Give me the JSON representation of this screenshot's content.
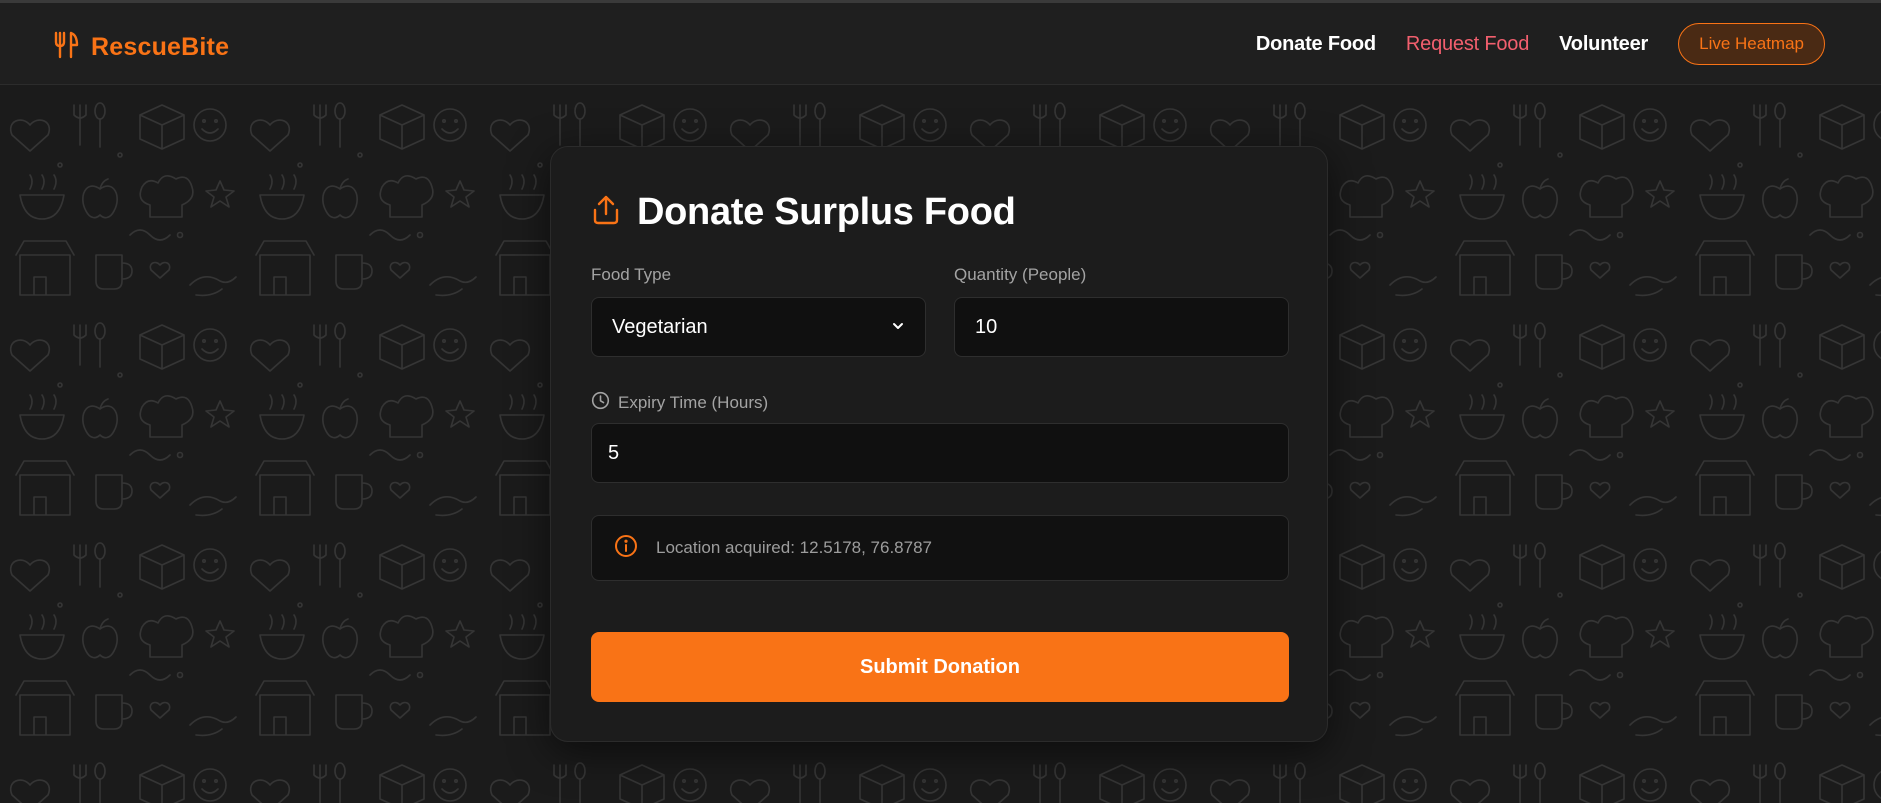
{
  "header": {
    "brand": "RescueBite",
    "nav": [
      {
        "label": "Donate Food",
        "active": false
      },
      {
        "label": "Request Food",
        "active": true
      },
      {
        "label": "Volunteer",
        "active": false
      }
    ],
    "heatmap_label": "Live Heatmap"
  },
  "form": {
    "title": "Donate Surplus Food",
    "food_type": {
      "label": "Food Type",
      "value": "Vegetarian"
    },
    "quantity": {
      "label": "Quantity (People)",
      "value": "10"
    },
    "expiry": {
      "label": "Expiry Time (Hours)",
      "value": "5"
    },
    "location_text": "Location acquired: 12.5178, 76.8787",
    "submit_label": "Submit Donation"
  },
  "colors": {
    "accent": "#f97316",
    "active_nav": "#f25f6e",
    "background": "#1b1b1b",
    "card": "#1c1c1c"
  }
}
